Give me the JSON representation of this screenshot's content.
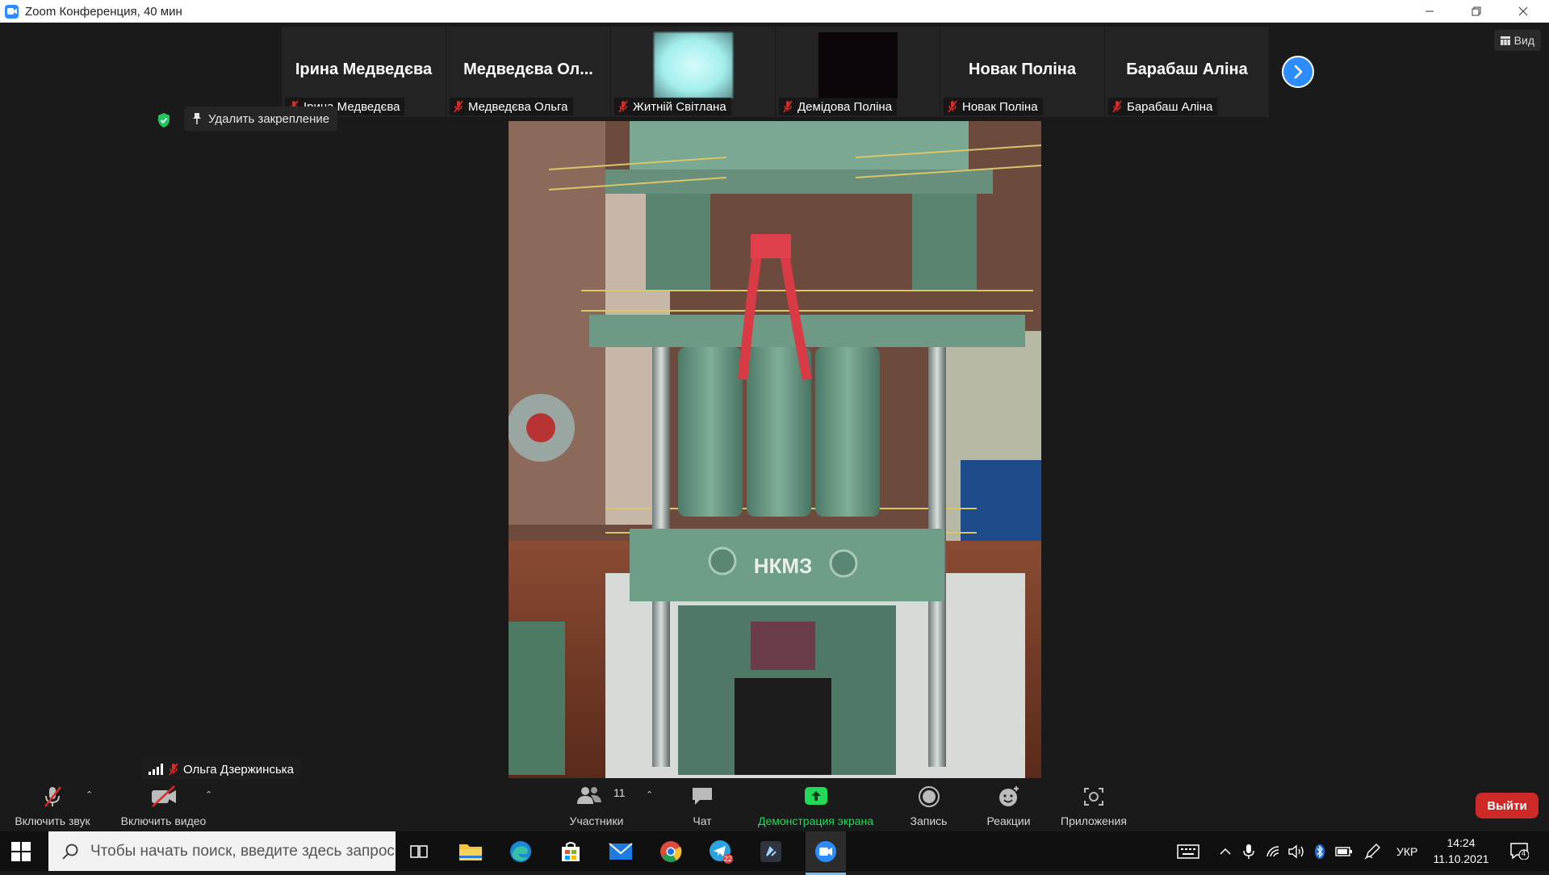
{
  "window": {
    "title": "Zoom Конференция, 40 мин",
    "minimize_icon": "minimize-icon",
    "restore_icon": "restore-icon",
    "close_icon": "close-icon"
  },
  "thumbnails": [
    {
      "display": "Ірина Медведєва",
      "label": "Ірина Медведєва",
      "type": "name"
    },
    {
      "display": "Медведєва  Ол...",
      "label": "Медведєва  Ольга",
      "type": "name"
    },
    {
      "display": "",
      "label": "Житній Світлана",
      "type": "video-light"
    },
    {
      "display": "",
      "label": "Демідова Поліна",
      "type": "video-dark"
    },
    {
      "display": "Новак Поліна",
      "label": "Новак Поліна",
      "type": "name"
    },
    {
      "display": "Барабаш Аліна",
      "label": "Барабаш Аліна",
      "type": "name"
    }
  ],
  "view_button": {
    "label": "Вид",
    "icon": "grid-icon"
  },
  "pin": {
    "label": "Удалить закрепление",
    "icon": "pin-icon",
    "security_icon": "shield-check-icon"
  },
  "main_video": {
    "speaker": "Ольга Дзержинська",
    "machine_text": "НКМЗ"
  },
  "toolbar": {
    "mute": {
      "label": "Включить звук",
      "icon": "mic-off-icon"
    },
    "video": {
      "label": "Включить видео",
      "icon": "video-off-icon"
    },
    "participants": {
      "label": "Участники",
      "count": "11",
      "icon": "participants-icon"
    },
    "chat": {
      "label": "Чат",
      "icon": "chat-icon"
    },
    "share": {
      "label": "Демонстрация экрана",
      "icon": "share-screen-icon",
      "color": "#23d959"
    },
    "record": {
      "label": "Запись",
      "icon": "record-icon"
    },
    "reactions": {
      "label": "Реакции",
      "icon": "reaction-icon"
    },
    "apps": {
      "label": "Приложения",
      "icon": "apps-icon"
    },
    "leave": {
      "label": "Выйти",
      "color": "#cd2a27"
    }
  },
  "taskbar": {
    "search_placeholder": "Чтобы начать поиск, введите здесь запрос",
    "telegram_badge": "22",
    "language": "УКР",
    "time": "14:24",
    "date": "11.10.2021",
    "notifications": "4"
  },
  "colors": {
    "accent": "#2d8cff",
    "mic_off": "#e02828"
  }
}
